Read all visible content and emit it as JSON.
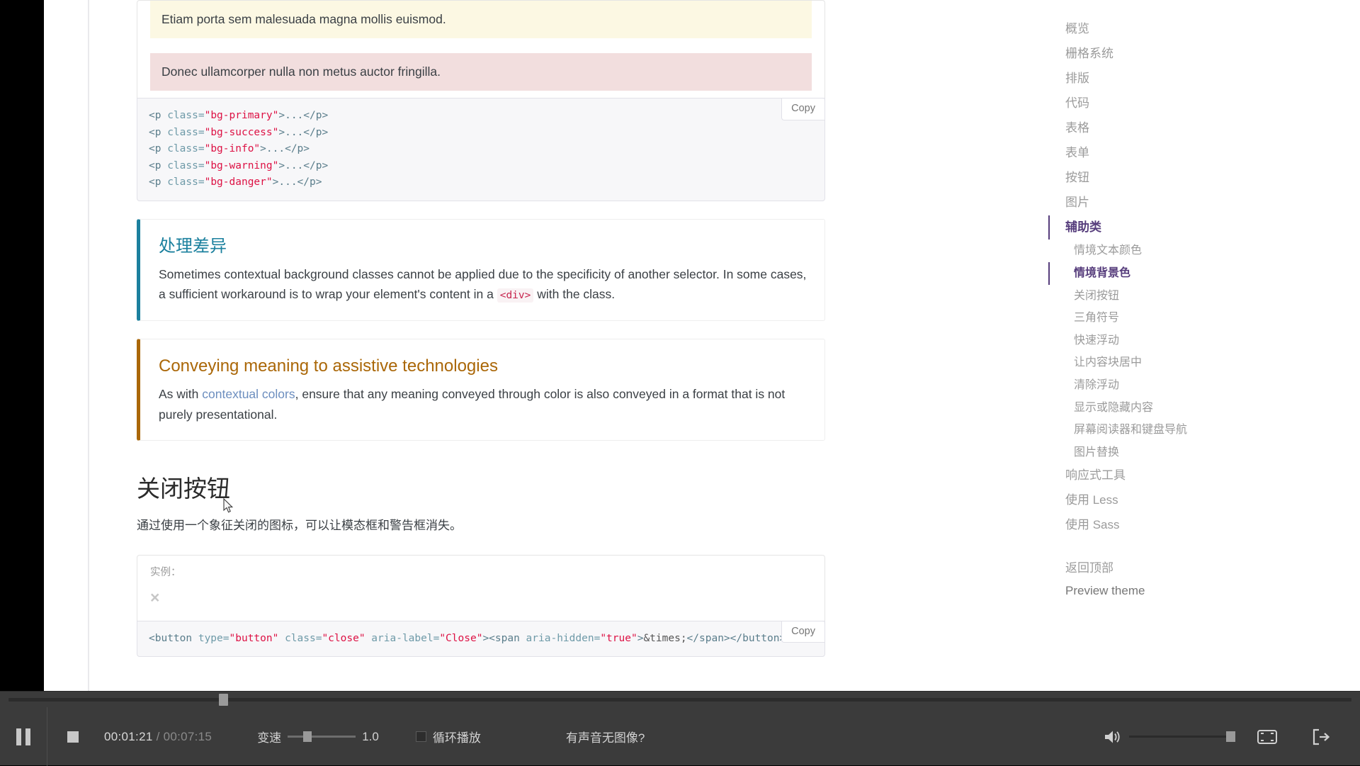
{
  "doc": {
    "examples": [
      {
        "id": "bg-warning",
        "text": "Etiam porta sem malesuada magna mollis euismod."
      },
      {
        "id": "bg-danger",
        "text": "Donec ullamcorper nulla non metus auctor fringilla."
      }
    ],
    "code_block_1": {
      "copy_label": "Copy",
      "lines": [
        {
          "tag_open": "<p ",
          "attr": "class=",
          "value": "\"bg-primary\"",
          "tag_close": ">...</p>"
        },
        {
          "tag_open": "<p ",
          "attr": "class=",
          "value": "\"bg-success\"",
          "tag_close": ">...</p>"
        },
        {
          "tag_open": "<p ",
          "attr": "class=",
          "value": "\"bg-info\"",
          "tag_close": ">...</p>"
        },
        {
          "tag_open": "<p ",
          "attr": "class=",
          "value": "\"bg-warning\"",
          "tag_close": ">...</p>"
        },
        {
          "tag_open": "<p ",
          "attr": "class=",
          "value": "\"bg-danger\"",
          "tag_close": ">...</p>"
        }
      ]
    },
    "callout_info": {
      "title": "处理差异",
      "text_part1": "Sometimes contextual background classes cannot be applied due to the specificity of another selector. In some cases, a sufficient workaround is to wrap your element's content in a ",
      "code": "<div>",
      "text_part2": " with the class."
    },
    "callout_warning": {
      "title": "Conveying meaning to assistive technologies",
      "text_part1": "As with ",
      "link": "contextual colors",
      "text_part2": ", ensure that any meaning conveyed through color is also conveyed in a format that is not purely presentational."
    },
    "section": {
      "heading": "关闭按钮",
      "paragraph": "通过使用一个象征关闭的图标，可以让模态框和警告框消失。"
    },
    "close_example": {
      "label": "实例：",
      "close_glyph": "×"
    },
    "code_block_2": {
      "copy_label": "Copy",
      "segments": [
        {
          "cls": "nt",
          "t": "<button "
        },
        {
          "cls": "na",
          "t": "type="
        },
        {
          "cls": "s",
          "t": "\"button\""
        },
        {
          "cls": "na",
          "t": " class="
        },
        {
          "cls": "s",
          "t": "\"close\""
        },
        {
          "cls": "na",
          "t": " aria-label="
        },
        {
          "cls": "s",
          "t": "\"Close\""
        },
        {
          "cls": "nt",
          "t": "><span "
        },
        {
          "cls": "na",
          "t": "aria-hidden="
        },
        {
          "cls": "s",
          "t": "\"true\""
        },
        {
          "cls": "nt",
          "t": ">"
        },
        {
          "cls": "plain",
          "t": "&times;"
        },
        {
          "cls": "nt",
          "t": "</span></button>"
        }
      ]
    }
  },
  "sidebar": {
    "items": [
      {
        "label": "概览",
        "active": false
      },
      {
        "label": "栅格系统",
        "active": false
      },
      {
        "label": "排版",
        "active": false
      },
      {
        "label": "代码",
        "active": false
      },
      {
        "label": "表格",
        "active": false
      },
      {
        "label": "表单",
        "active": false
      },
      {
        "label": "按钮",
        "active": false
      },
      {
        "label": "图片",
        "active": false
      },
      {
        "label": "辅助类",
        "active": true
      }
    ],
    "sub_items": [
      {
        "label": "情境文本颜色",
        "active": false
      },
      {
        "label": "情境背景色",
        "active": true
      },
      {
        "label": "关闭按钮",
        "active": false
      },
      {
        "label": "三角符号",
        "active": false
      },
      {
        "label": "快速浮动",
        "active": false
      },
      {
        "label": "让内容块居中",
        "active": false
      },
      {
        "label": "清除浮动",
        "active": false
      },
      {
        "label": "显示或隐藏内容",
        "active": false
      },
      {
        "label": "屏幕阅读器和键盘导航",
        "active": false
      },
      {
        "label": "图片替换",
        "active": false
      }
    ],
    "items_after": [
      {
        "label": "响应式工具",
        "active": false
      },
      {
        "label": "使用 Less",
        "active": false
      },
      {
        "label": "使用 Sass",
        "active": false
      }
    ],
    "back_to_top": "返回顶部",
    "preview_theme": "Preview theme"
  },
  "player": {
    "pause_icon": "pause-icon",
    "stop_icon": "stop-icon",
    "time_current": "00:01:21",
    "time_separator": "/",
    "time_total": "00:07:15",
    "speed_label": "变速",
    "speed_value": "1.0",
    "loop_label": "循环播放",
    "audio_no_video_label": "有声音无图像?",
    "volume_icon": "volume-icon",
    "fullscreen_icon": "fullscreen-icon",
    "exit_icon": "exit-icon"
  },
  "colors": {
    "accent_purple": "#563d7c",
    "callout_info": "#1b809e",
    "callout_warning": "#aa6708",
    "code_string": "#d14",
    "bg_warning": "#fcf8e3",
    "bg_danger": "#f2dede",
    "player_bg": "#3b3b3b"
  }
}
